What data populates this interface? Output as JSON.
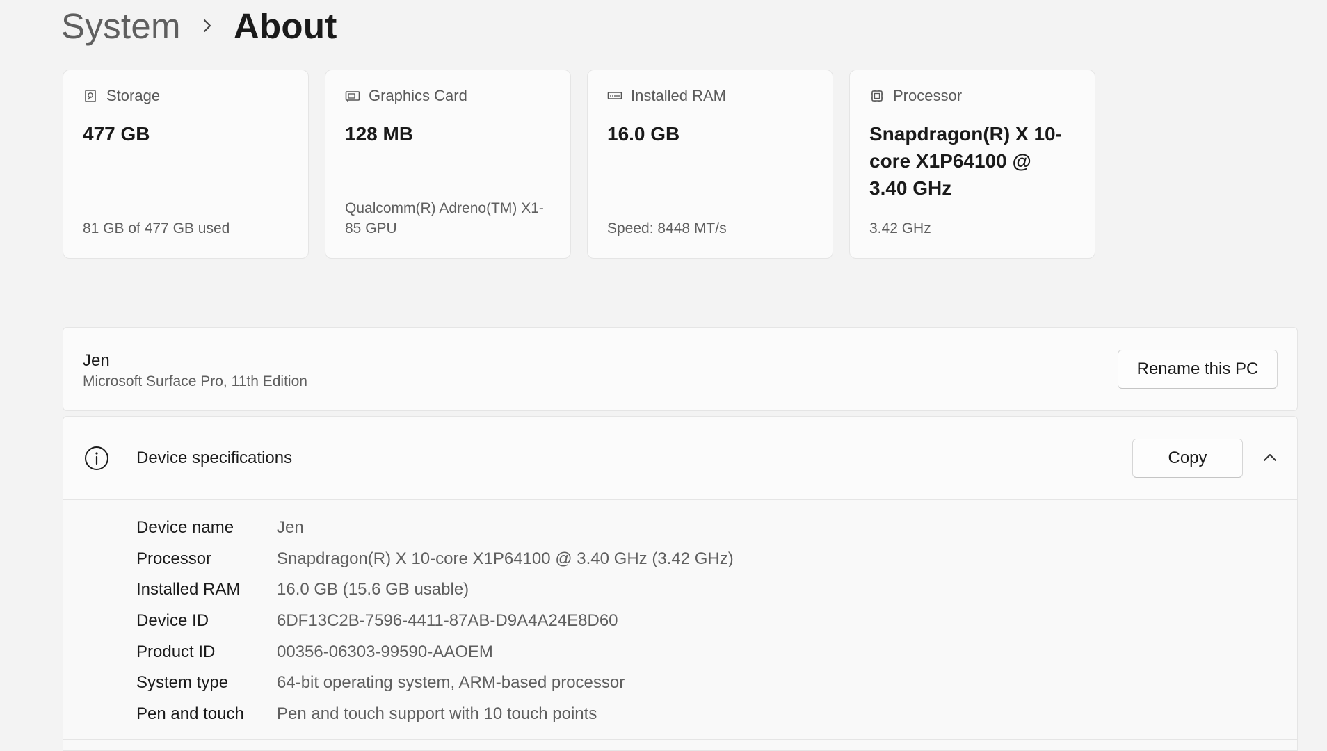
{
  "breadcrumb": {
    "parent": "System",
    "current": "About"
  },
  "cards": [
    {
      "icon": "storage-icon",
      "title": "Storage",
      "value": "477 GB",
      "sub": "81 GB of 477 GB used"
    },
    {
      "icon": "graphics-card-icon",
      "title": "Graphics Card",
      "value": "128 MB",
      "sub": "Qualcomm(R) Adreno(TM) X1-85 GPU"
    },
    {
      "icon": "ram-icon",
      "title": "Installed RAM",
      "value": "16.0 GB",
      "sub": "Speed: 8448 MT/s"
    },
    {
      "icon": "processor-icon",
      "title": "Processor",
      "value": "Snapdragon(R) X 10-core X1P64100 @ 3.40 GHz",
      "sub": "3.42 GHz"
    }
  ],
  "pc": {
    "name": "Jen",
    "model": "Microsoft Surface Pro, 11th Edition",
    "rename_label": "Rename this PC"
  },
  "specs": {
    "title": "Device specifications",
    "copy_label": "Copy",
    "rows": [
      {
        "label": "Device name",
        "value": "Jen"
      },
      {
        "label": "Processor",
        "value": "Snapdragon(R) X 10-core X1P64100 @ 3.40 GHz (3.42 GHz)"
      },
      {
        "label": "Installed RAM",
        "value": "16.0 GB (15.6 GB usable)"
      },
      {
        "label": "Device ID",
        "value": "6DF13C2B-7596-4411-87AB-D9A4A24E8D60"
      },
      {
        "label": "Product ID",
        "value": "00356-06303-99590-AAOEM"
      },
      {
        "label": "System type",
        "value": "64-bit operating system, ARM-based processor"
      },
      {
        "label": "Pen and touch",
        "value": "Pen and touch support with 10 touch points"
      }
    ]
  }
}
